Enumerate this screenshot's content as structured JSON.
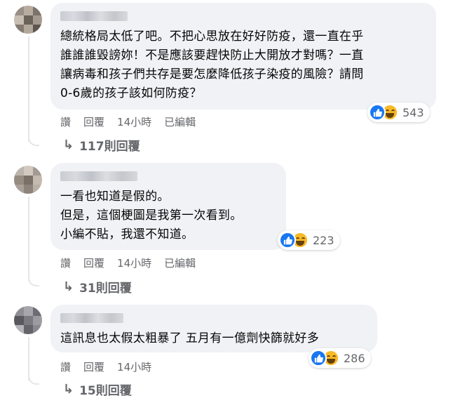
{
  "comments": [
    {
      "lines": [
        "總統格局太低了吧。不把心思放在好好防疫，還一直在乎",
        "誰誰誰毀謗妳！不是應該要趕快防止大開放才對嗎？一直",
        "讓病毒和孩子們共存是要怎麼降低孩子染疫的風險？請問",
        "0-6歲的孩子該如何防疫？"
      ],
      "reaction_count": "543",
      "actions": {
        "like": "讚",
        "reply": "回覆",
        "time": "14小時",
        "edited": "已編輯"
      },
      "replies": "117則回覆"
    },
    {
      "lines": [
        "一看也知道是假的。",
        "但是，這個梗圖是我第一次看到。",
        "小編不貼，我還不知道。"
      ],
      "reaction_count": "223",
      "actions": {
        "like": "讚",
        "reply": "回覆",
        "time": "14小時",
        "edited": "已編輯"
      },
      "replies": "31則回覆"
    },
    {
      "lines": [
        "這訊息也太假太粗暴了 五月有一億劑快篩就好多"
      ],
      "reaction_count": "286",
      "actions": {
        "like": "讚",
        "reply": "回覆",
        "time": "14小時"
      },
      "replies": "15則回覆"
    }
  ],
  "icons": {
    "like": "like-icon",
    "haha": "haha-icon",
    "reply_arrow": "reply-arrow-icon"
  },
  "colors": {
    "bubble": "#f0f2f5",
    "like": "#1877f2",
    "haha": "#f7b928",
    "meta_text": "#65676b"
  }
}
